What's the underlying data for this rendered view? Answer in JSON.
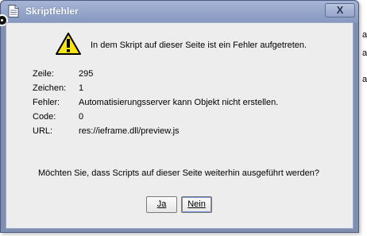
{
  "window": {
    "title": "Skriptfehler",
    "close_label": "X"
  },
  "dialog": {
    "message": "In dem Skript auf dieser Seite ist ein Fehler aufgetreten.",
    "details": [
      {
        "label": "Zeile:",
        "value": "295"
      },
      {
        "label": "Zeichen:",
        "value": "1"
      },
      {
        "label": "Fehler:",
        "value": "Automatisierungsserver kann Objekt nicht erstellen."
      },
      {
        "label": "Code:",
        "value": "0"
      },
      {
        "label": "URL:",
        "value": "res://ieframe.dll/preview.js"
      }
    ],
    "question": "Möchten Sie, dass Scripts auf dieser Seite weiterhin ausgeführt werden?",
    "yes_label": "Ja",
    "no_label": "Nein"
  },
  "background": {
    "fragments": [
      "a",
      "a",
      "a"
    ]
  },
  "icons": {
    "title_icon": "document-icon",
    "warning_icon": "warning-icon"
  },
  "colors": {
    "titlebar": "#8798c0",
    "client": "#ededed",
    "warning_yellow": "#f7e316"
  }
}
